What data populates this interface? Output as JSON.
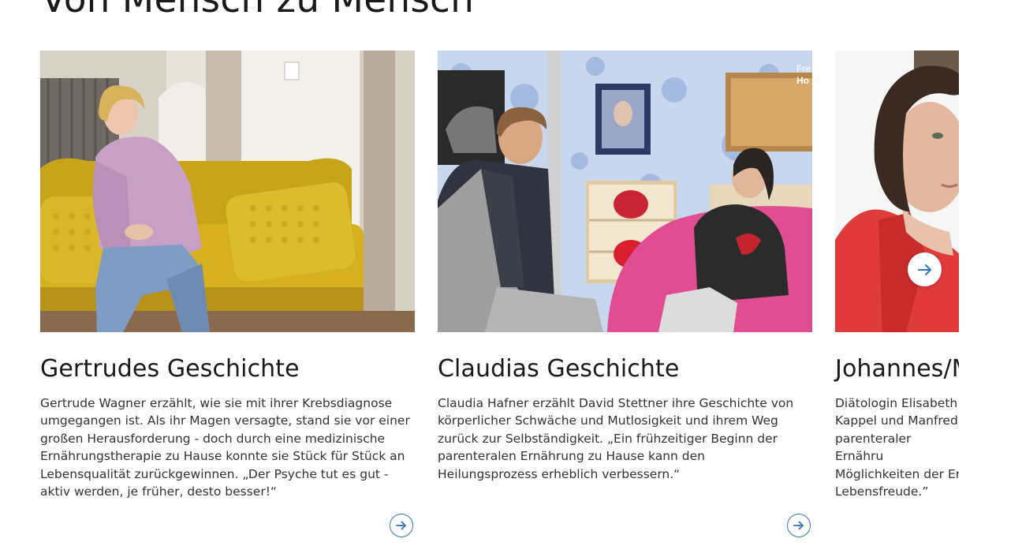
{
  "section": {
    "title": "Von Mensch zu Mensch"
  },
  "cards": [
    {
      "title": "Gertrudes Geschichte",
      "text": "Gertrude Wagner erzählt, wie sie mit ihrer Krebsdiagnose umgegangen ist. Als ihr Magen versagte, stand sie vor einer großen Herausforderung - doch durch eine medizinische Ernährungstherapie zu Hause konnte sie Stück für Stück an Lebensqualität zurückgewinnen. „Der Psyche tut es gut - aktiv werden, je früher, desto besser!“",
      "image_icon": "photo-woman-on-yellow-sofa"
    },
    {
      "title": "Claudias Geschichte",
      "text": "Claudia Hafner erzählt David Stettner ihre Geschichte von körperlicher Schwäche und Mutlosigkeit und ihrem Weg zurück zur Selbständigkeit. „Ein frühzeitiger Beginn der parenteralen Ernährung zu Hause kann den Heilungsprozess erheblich verbessern.“",
      "image_icon": "photo-interview-two-people",
      "image_overlay_line1": "Fre",
      "image_overlay_line2": "Ho"
    },
    {
      "title": "Johannes/M",
      "text": "Diätologin Elisabeth Kappel und Manfred parenteraler Ernähru Möglichkeiten der Er Lebensfreude.”",
      "image_icon": "photo-woman-red-jacket"
    }
  ],
  "colors": {
    "accent": "#2f74c0"
  },
  "icons": {
    "card_link": "arrow-right-circle-icon",
    "carousel_next": "arrow-right-icon"
  }
}
